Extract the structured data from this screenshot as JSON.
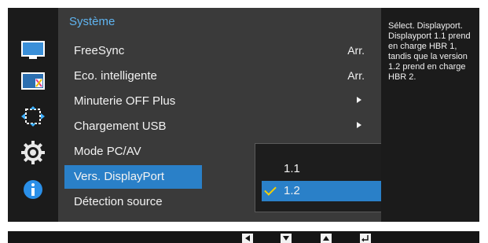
{
  "panel": {
    "title": "Système",
    "items": [
      {
        "label": "FreeSync",
        "value": "Arr."
      },
      {
        "label": "Eco. intelligente",
        "value": "Arr."
      },
      {
        "label": "Minuterie OFF Plus",
        "value": ""
      },
      {
        "label": "Chargement USB",
        "value": ""
      },
      {
        "label": "Mode PC/AV",
        "value": ""
      },
      {
        "label": "Vers. DisplayPort",
        "value": ""
      },
      {
        "label": "Détection source",
        "value": ""
      }
    ]
  },
  "submenu": {
    "options": [
      {
        "label": "1.1"
      },
      {
        "label": "1.2"
      }
    ]
  },
  "help": {
    "text": "Sélect. Displayport. Displayport 1.1 prend en charge HBR 1, tandis que la version 1.2 prend en charge HBR 2."
  },
  "colors": {
    "accent": "#2a80c8",
    "title": "#5fb4f0",
    "check": "#f4d000"
  },
  "icons": {
    "sidebar": [
      "picture-icon",
      "color-icon",
      "size-position-icon",
      "setup-gear-icon",
      "information-icon"
    ],
    "navbar": [
      "left-arrow-icon",
      "down-arrow-icon",
      "up-arrow-icon",
      "enter-icon"
    ]
  }
}
